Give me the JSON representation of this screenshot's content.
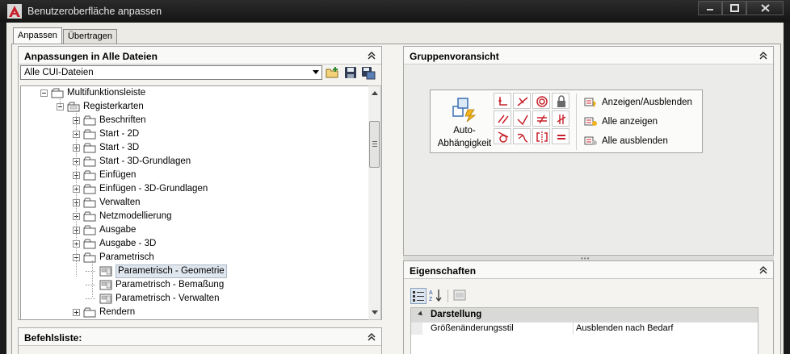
{
  "window": {
    "title": "Benutzeroberfläche anpassen",
    "buttons": [
      "minimize",
      "maximize",
      "close"
    ]
  },
  "tabs": [
    {
      "label": "Anpassen",
      "active": true
    },
    {
      "label": "Übertragen",
      "active": false
    }
  ],
  "customizations_panel": {
    "title": "Anpassungen in Alle Dateien",
    "dropdown_value": "Alle CUI-Dateien",
    "toolbar_icons": [
      "open-file-icon",
      "save-icon",
      "save-as-icon"
    ],
    "tree": [
      {
        "label": "Multifunktionsleiste",
        "level": 0,
        "expander": "minus",
        "icon": "ribbon-icon"
      },
      {
        "label": "Registerkarten",
        "level": 1,
        "expander": "minus",
        "icon": "tabs-folder-icon"
      },
      {
        "label": "Beschriften",
        "level": 2,
        "expander": "plus",
        "icon": "tab-icon"
      },
      {
        "label": "Start - 2D",
        "level": 2,
        "expander": "plus",
        "icon": "tab-icon"
      },
      {
        "label": "Start - 3D",
        "level": 2,
        "expander": "plus",
        "icon": "tab-icon"
      },
      {
        "label": "Start - 3D-Grundlagen",
        "level": 2,
        "expander": "plus",
        "icon": "tab-icon"
      },
      {
        "label": "Einfügen",
        "level": 2,
        "expander": "plus",
        "icon": "tab-icon"
      },
      {
        "label": "Einfügen - 3D-Grundlagen",
        "level": 2,
        "expander": "plus",
        "icon": "tab-icon"
      },
      {
        "label": "Verwalten",
        "level": 2,
        "expander": "plus",
        "icon": "tab-icon"
      },
      {
        "label": "Netzmodellierung",
        "level": 2,
        "expander": "plus",
        "icon": "tab-icon"
      },
      {
        "label": "Ausgabe",
        "level": 2,
        "expander": "plus",
        "icon": "tab-icon"
      },
      {
        "label": "Ausgabe - 3D",
        "level": 2,
        "expander": "plus",
        "icon": "tab-icon"
      },
      {
        "label": "Parametrisch",
        "level": 2,
        "expander": "minus",
        "icon": "tab-icon"
      },
      {
        "label": "Parametrisch - Geometrie",
        "level": 3,
        "expander": "none",
        "icon": "panel-icon",
        "selected": true
      },
      {
        "label": "Parametrisch - Bemaßung",
        "level": 3,
        "expander": "none",
        "icon": "panel-icon"
      },
      {
        "label": "Parametrisch - Verwalten",
        "level": 3,
        "expander": "none",
        "icon": "panel-icon"
      },
      {
        "label": "Rendern",
        "level": 2,
        "expander": "plus",
        "icon": "tab-icon"
      }
    ]
  },
  "command_list_panel": {
    "title": "Befehlsliste:"
  },
  "group_preview_panel": {
    "title": "Gruppenvoransicht",
    "big_button_line1": "Auto-",
    "big_button_line2": "Abhängigkeit",
    "commands": [
      {
        "label": "Anzeigen/Ausblenden",
        "icon": "show-hide-constraint-icon"
      },
      {
        "label": "Alle anzeigen",
        "icon": "show-all-constraints-icon"
      },
      {
        "label": "Alle ausblenden",
        "icon": "hide-all-constraints-icon"
      }
    ]
  },
  "properties_panel": {
    "title": "Eigenschaften",
    "toolbar_icons": [
      "categorized-icon",
      "alphabetical-icon",
      "property-pages-icon"
    ],
    "category": "Darstellung",
    "rows": [
      {
        "key": "Größenänderungsstil",
        "value": "Ausblenden nach Bedarf"
      }
    ]
  },
  "colors": {
    "titlebar": "#1a1a1a",
    "client": "#ecebe6",
    "selection": "#dfe6ee",
    "constraint_red": "#c8202a"
  }
}
